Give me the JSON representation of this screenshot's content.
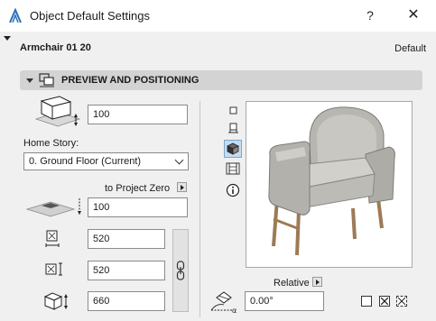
{
  "window": {
    "title": "Object Default Settings",
    "help_label": "?",
    "close_label": "✕"
  },
  "header": {
    "object_name": "Armchair 01 20",
    "default_label": "Default"
  },
  "section": {
    "title": "PREVIEW AND POSITIONING"
  },
  "positioning": {
    "elevation_value": "100",
    "home_story_label": "Home Story:",
    "home_story_value": "0. Ground Floor (Current)",
    "to_project_zero_label": "to Project Zero",
    "project_zero_value": "100",
    "width_value": "520",
    "depth_value": "520",
    "height_value": "660",
    "relative_label": "Relative",
    "rotation_value": "0.00°"
  },
  "icons": {
    "app": "archicad-icon",
    "view_modes": [
      "2d-symbol-icon",
      "floor-plan-icon",
      "3d-view-icon",
      "section-view-icon",
      "info-icon"
    ],
    "active_view": "3d-view-icon"
  },
  "colors": {
    "dialog_bg": "#f0f0f0",
    "section_bg": "#d3d3d3",
    "active_icon_bg": "#c5dcef"
  }
}
